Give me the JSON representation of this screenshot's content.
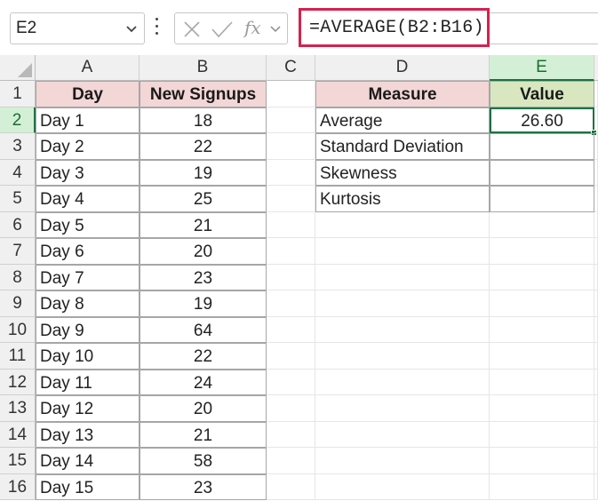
{
  "formula_bar": {
    "name_box": "E2",
    "fx_label": "fx",
    "formula": "=AVERAGE(B2:B16)"
  },
  "columns": [
    "A",
    "B",
    "C",
    "D",
    "E"
  ],
  "rows": [
    "1",
    "2",
    "3",
    "4",
    "5",
    "6",
    "7",
    "8",
    "9",
    "10",
    "11",
    "12",
    "13",
    "14",
    "15",
    "16"
  ],
  "signups_table": {
    "headers": [
      "Day",
      "New Signups"
    ],
    "rows": [
      [
        "Day 1",
        "18"
      ],
      [
        "Day 2",
        "22"
      ],
      [
        "Day 3",
        "19"
      ],
      [
        "Day 4",
        "25"
      ],
      [
        "Day 5",
        "21"
      ],
      [
        "Day 6",
        "20"
      ],
      [
        "Day 7",
        "23"
      ],
      [
        "Day 8",
        "19"
      ],
      [
        "Day 9",
        "64"
      ],
      [
        "Day 10",
        "22"
      ],
      [
        "Day 11",
        "24"
      ],
      [
        "Day 12",
        "20"
      ],
      [
        "Day 13",
        "21"
      ],
      [
        "Day 14",
        "58"
      ],
      [
        "Day 15",
        "23"
      ]
    ]
  },
  "stats_table": {
    "headers": [
      "Measure",
      "Value"
    ],
    "rows": [
      [
        "Average",
        "26.60"
      ],
      [
        "Standard Deviation",
        ""
      ],
      [
        "Skewness",
        ""
      ],
      [
        "Kurtosis",
        ""
      ]
    ]
  },
  "active_cell": "E2",
  "colors": {
    "accent": "#1e7145",
    "formula_highlight": "#d6214e",
    "header_pink": "#f3d6d6",
    "header_green": "#d8e7bf"
  }
}
